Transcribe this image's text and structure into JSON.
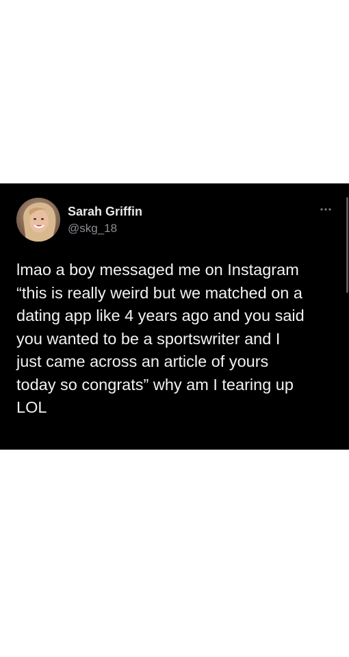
{
  "tweet": {
    "author": {
      "display_name": "Sarah Griffin",
      "handle": "@skg_18",
      "avatar_icon": "profile-photo"
    },
    "more_icon": "more-dots-icon",
    "text_lines": [
      "lmao a boy messaged me on Instagram",
      "“this is really weird but we matched on a",
      "dating app like 4 years ago and you said",
      "you wanted to be a sportswriter and I",
      "just came across an article of yours",
      "today so congrats” why am I tearing up",
      "LOL"
    ]
  },
  "colors": {
    "page_background": "#ffffff",
    "card_background": "#000000",
    "name_color": "#e7e9ea",
    "handle_color": "#8b8f94",
    "text_color": "#f2f2f2"
  }
}
